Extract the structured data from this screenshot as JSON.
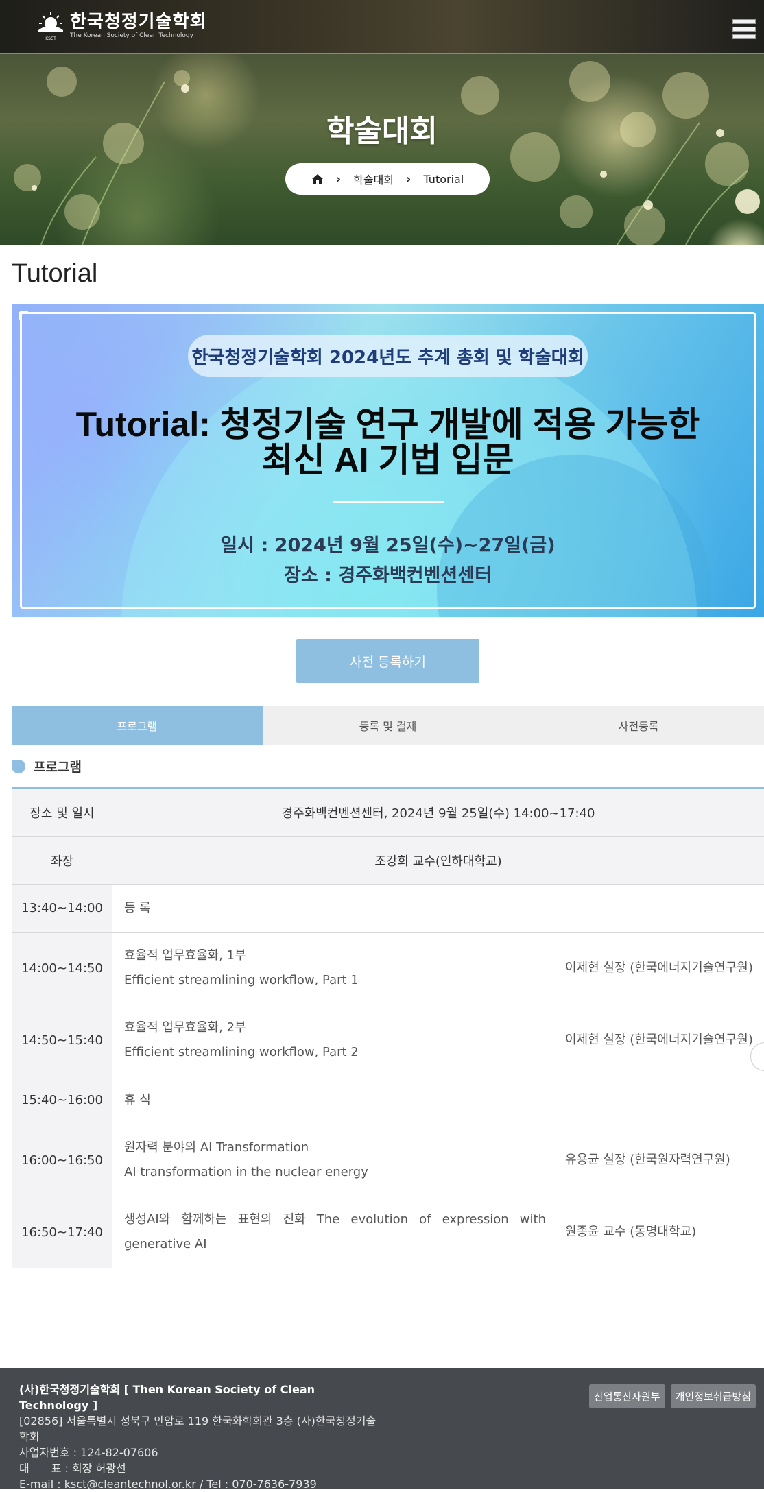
{
  "header": {
    "logo_kr": "한국청정기술학회",
    "logo_en": "The Korean Society of Clean Technology",
    "logo_abbr": "KSCT"
  },
  "hero": {
    "title": "학술대회",
    "breadcrumb": [
      "학술대회",
      "Tutorial"
    ]
  },
  "page": {
    "title": "Tutorial"
  },
  "banner": {
    "chip": "한국청정기술학회 2024년도 추계 총회 및 학술대회",
    "headline_line1": "Tutorial: 청정기술 연구 개발에 적용 가능한",
    "headline_line2": "최신 AI 기법 입문",
    "date": "일시 : 2024년 9월 25일(수)~27일(금)",
    "venue": "장소 : 경주화백컨벤션센터"
  },
  "register_button": "사전 등록하기",
  "tabs": [
    "프로그램",
    "등록 및 결제",
    "사전등록"
  ],
  "section_title": "프로그램",
  "schedule": {
    "venue_label": "장소 및 일시",
    "venue_value": "경주화백컨벤션센터, 2024년 9월 25일(수) 14:00~17:40",
    "chair_label": "좌장",
    "chair_value": "조강희 교수(인하대학교)",
    "rows": [
      {
        "time": "13:40~14:00",
        "title": "등 록",
        "title_en": "",
        "speaker": ""
      },
      {
        "time": "14:00~14:50",
        "title": "효율적 업무효율화, 1부",
        "title_en": "Efficient streamlining workflow, Part 1",
        "speaker": "이제현 실장 (한국에너지기술연구원)"
      },
      {
        "time": "14:50~15:40",
        "title": "효율적 업무효율화, 2부",
        "title_en": "Efficient streamlining workflow, Part 2",
        "speaker": "이제현 실장 (한국에너지기술연구원)"
      },
      {
        "time": "15:40~16:00",
        "title": "휴 식",
        "title_en": "",
        "speaker": ""
      },
      {
        "time": "16:00~16:50",
        "title": "원자력 분야의 AI Transformation",
        "title_en": "AI transformation in the nuclear energy",
        "speaker": "유용균 실장 (한국원자력연구원)"
      },
      {
        "time": "16:50~17:40",
        "title": "생성AI와 함께하는 표현의 진화 The evolution of expression with generative AI",
        "title_en": "",
        "speaker": "원종윤 교수 (동명대학교)"
      }
    ]
  },
  "footer": {
    "name": "(사)한국청정기술학회 [ Then Korean Society of Clean Technology ]",
    "address": "[02856] 서울특별시 성북구 안암로 119 한국화학회관 3층 (사)한국청정기술학회",
    "biz_no": "사업자번호 : 124-82-07606",
    "rep": "대　　표 : 회장 허광선",
    "contact": "E-mail : ksct@cleantechnol.or.kr / Tel : 070-7636-7939",
    "buttons": [
      "산업통산자원부",
      "개인정보취급방침"
    ]
  },
  "colors": {
    "accent": "#8ebfe1",
    "footer_bg": "#46494d",
    "banner_title": "#1e3d7a"
  },
  "icons": [
    "menu-icon",
    "home-icon",
    "chevron-right-icon",
    "leaf-icon"
  ]
}
